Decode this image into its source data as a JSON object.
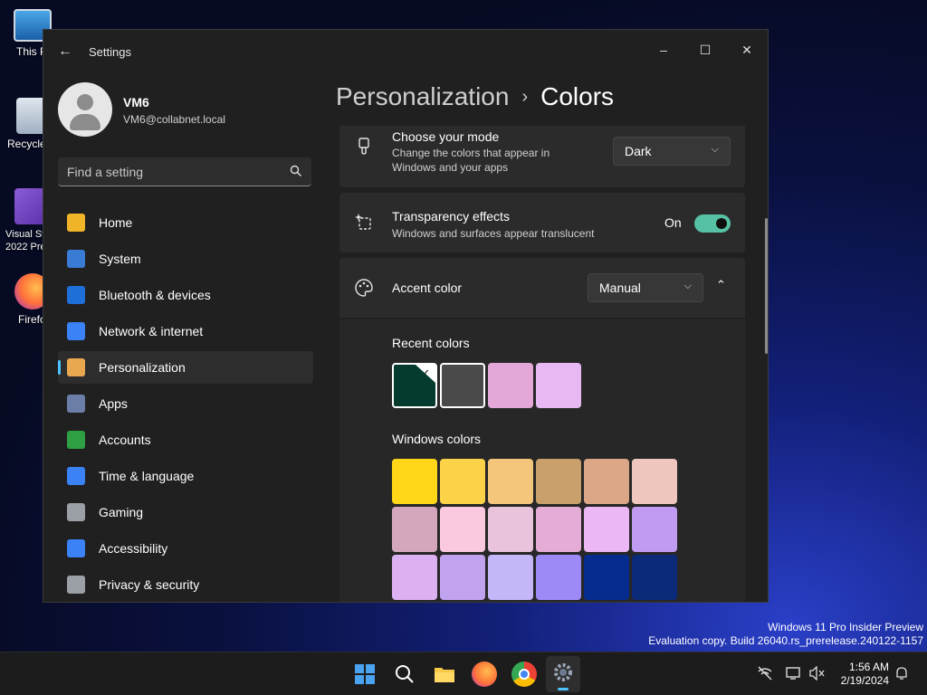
{
  "desktop": {
    "icons": [
      {
        "label": "This P",
        "icon": "monitor-icon"
      },
      {
        "label": "Recycle",
        "icon": "recycle-bin-icon"
      },
      {
        "label": "Visual St\n2022 Pre",
        "icon": "visual-studio-icon"
      },
      {
        "label": "Firefo",
        "icon": "firefox-icon"
      }
    ],
    "watermark_line1": "Windows 11 Pro Insider Preview",
    "watermark_line2": "Evaluation copy. Build 26040.rs_prerelease.240122-1157"
  },
  "window": {
    "title": "Settings",
    "controls": {
      "minimize": "–",
      "maximize": "☐",
      "close": "✕"
    }
  },
  "profile": {
    "name": "VM6",
    "email": "VM6@collabnet.local"
  },
  "search": {
    "placeholder": "Find a setting"
  },
  "nav": [
    {
      "label": "Home",
      "icon": "home-icon",
      "color": "#f0b429"
    },
    {
      "label": "System",
      "icon": "system-icon",
      "color": "#3a7bd5"
    },
    {
      "label": "Bluetooth & devices",
      "icon": "bluetooth-icon",
      "color": "#1f6fd9"
    },
    {
      "label": "Network & internet",
      "icon": "network-icon",
      "color": "#3b82f6"
    },
    {
      "label": "Personalization",
      "icon": "brush-icon",
      "color": "#e8a850",
      "active": true
    },
    {
      "label": "Apps",
      "icon": "apps-icon",
      "color": "#6b7ea8"
    },
    {
      "label": "Accounts",
      "icon": "accounts-icon",
      "color": "#2ea043"
    },
    {
      "label": "Time & language",
      "icon": "clock-globe-icon",
      "color": "#3b82f6"
    },
    {
      "label": "Gaming",
      "icon": "gamepad-icon",
      "color": "#9aa0a6"
    },
    {
      "label": "Accessibility",
      "icon": "accessibility-icon",
      "color": "#3b82f6"
    },
    {
      "label": "Privacy & security",
      "icon": "shield-icon",
      "color": "#9aa0a6"
    }
  ],
  "breadcrumb": {
    "parent": "Personalization",
    "separator": "›",
    "current": "Colors"
  },
  "mode_card": {
    "title": "Choose your mode",
    "subtitle_line1": "Change the colors that appear in",
    "subtitle_line2": "Windows and your apps",
    "value": "Dark"
  },
  "transparency_card": {
    "title": "Transparency effects",
    "subtitle": "Windows and surfaces appear translucent",
    "state": "On"
  },
  "accent_card": {
    "title": "Accent color",
    "value": "Manual",
    "recent_label": "Recent colors",
    "recent_colors": [
      "#053a2f",
      "#4a4a4a",
      "#e3a8d8",
      "#e7b8f2"
    ],
    "windows_label": "Windows colors",
    "windows_colors": [
      "#ffd718",
      "#fcd249",
      "#f4c67b",
      "#c9a06b",
      "#dba787",
      "#eec6bd",
      "#d5a7bd",
      "#fac8df",
      "#e8c3db",
      "#e6acd8",
      "#ebb8f5",
      "#c19bf2",
      "#dbb1f2",
      "#c1a2ef",
      "#c5b6f8",
      "#9d8af7",
      "#062c8f",
      "#0b2a7a",
      "#8fa5e8",
      "#5f73e6",
      "#7b88ec",
      "#5c66cc",
      "#b6b1f5",
      "#8f76f7"
    ]
  },
  "taskbar": {
    "apps": [
      "windows-start-icon",
      "search-icon",
      "file-explorer-icon",
      "firefox-icon",
      "chrome-icon",
      "settings-icon"
    ],
    "time": "1:56 AM",
    "date": "2/19/2024"
  }
}
